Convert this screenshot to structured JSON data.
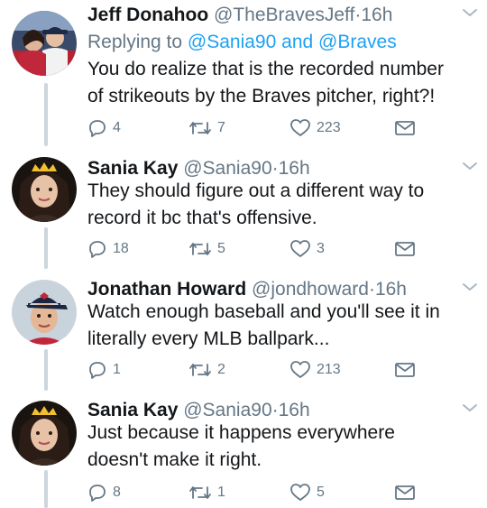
{
  "tweets": [
    {
      "name": "Jeff Donahoo",
      "handle": "@TheBravesJeff",
      "separator": "·",
      "time": "16h",
      "reply_prefix": "Replying to",
      "reply_to_1": "@Sania90",
      "reply_and": "and",
      "reply_to_2": "@Braves",
      "text_line_1": "You do realize that is the recorded number",
      "text_line_2": "of strikeouts by the Braves pitcher, right?!",
      "replies": "4",
      "retweets": "7",
      "likes": "223",
      "avatar": "avatar-couple-stadium"
    },
    {
      "name": "Sania Kay",
      "handle": "@Sania90",
      "separator": "·",
      "time": "16h",
      "text_line_1": "They should figure out a different way to",
      "text_line_2": "record it bc that's offensive.",
      "replies": "18",
      "retweets": "5",
      "likes": "3",
      "avatar": "avatar-woman-crown"
    },
    {
      "name": "Jonathan Howard",
      "handle": "@jondhoward",
      "separator": "·",
      "time": "16h",
      "text_line_1": "Watch enough baseball and you'll see it in",
      "text_line_2": "literally every MLB ballpark...",
      "replies": "1",
      "retweets": "2",
      "likes": "213",
      "avatar": "avatar-man-cap"
    },
    {
      "name": "Sania Kay",
      "handle": "@Sania90",
      "separator": "·",
      "time": "16h",
      "text_line_1": "Just because it happens everywhere",
      "text_line_2": "doesn't make it right.",
      "replies": "8",
      "retweets": "1",
      "likes": "5",
      "avatar": "avatar-woman-crown"
    }
  ],
  "icons": {
    "reply": "reply-icon",
    "retweet": "retweet-icon",
    "like": "heart-icon",
    "message": "envelope-icon",
    "menu": "chevron-down-icon"
  },
  "colors": {
    "name": "#14171a",
    "secondary": "#657786",
    "link": "#1da1f2",
    "thread_line": "#ccd6dd"
  }
}
